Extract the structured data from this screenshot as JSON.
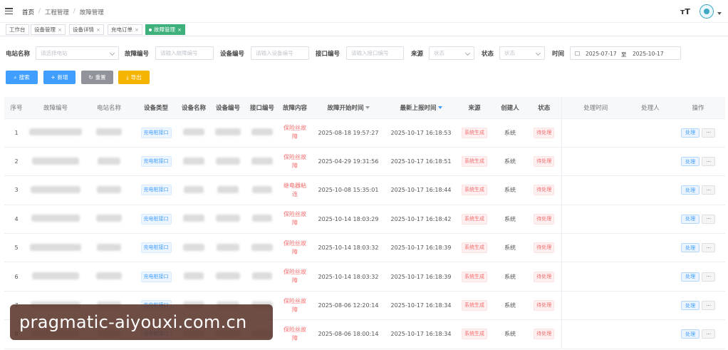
{
  "breadcrumb": [
    "首页",
    "工程管理",
    "故障管理"
  ],
  "header": {
    "font_size_label": "тT"
  },
  "tabs": [
    {
      "label": "工作台",
      "closable": false,
      "active": false
    },
    {
      "label": "设备管理",
      "closable": true,
      "active": false
    },
    {
      "label": "设备详情",
      "closable": true,
      "active": false
    },
    {
      "label": "充电订单",
      "closable": true,
      "active": false
    },
    {
      "label": "故障管理",
      "closable": true,
      "active": true
    }
  ],
  "filters": {
    "station_label": "电站名称",
    "station_placeholder": "请选择电站",
    "fault_no_label": "故障编号",
    "fault_no_placeholder": "请输入故障编号",
    "device_no_label": "设备编号",
    "device_no_placeholder": "请输入设备编号",
    "port_no_label": "接口编号",
    "port_no_placeholder": "请输入接口编号",
    "source_label": "来源",
    "source_placeholder": "状态",
    "status_label": "状态",
    "status_placeholder": "状态",
    "time_label": "时间",
    "date_from": "2025-07-17",
    "date_sep": "至",
    "date_to": "2025-10-17"
  },
  "actions": {
    "search": "搜索",
    "add": "新增",
    "reset": "重置",
    "export": "导出"
  },
  "table": {
    "columns": [
      "序号",
      "故障编号",
      "电站名称",
      "设备类型",
      "设备名称",
      "设备编号",
      "接口编号",
      "故障内容",
      "故障开始时间",
      "最新上报时间",
      "来源",
      "创建人",
      "状态",
      "处理时间",
      "处理人",
      "操作"
    ],
    "rows": [
      {
        "idx": "1",
        "type": "充电桩接口",
        "content": "保险丝故障",
        "start": "2025-08-18 19:57:27",
        "latest": "2025-10-17 16:18:53",
        "source": "系统生成",
        "creator": "系统",
        "status": "待处理"
      },
      {
        "idx": "2",
        "type": "充电桩接口",
        "content": "保险丝故障",
        "start": "2025-04-29 19:31:56",
        "latest": "2025-10-17 16:18:51",
        "source": "系统生成",
        "creator": "系统",
        "status": "待处理"
      },
      {
        "idx": "3",
        "type": "充电桩接口",
        "content": "继电器粘连",
        "start": "2025-10-08 15:35:01",
        "latest": "2025-10-17 16:18:44",
        "source": "系统生成",
        "creator": "系统",
        "status": "待处理"
      },
      {
        "idx": "4",
        "type": "充电桩接口",
        "content": "保险丝故障",
        "start": "2025-10-14 18:03:29",
        "latest": "2025-10-17 16:18:42",
        "source": "系统生成",
        "creator": "系统",
        "status": "待处理"
      },
      {
        "idx": "5",
        "type": "充电桩接口",
        "content": "保险丝故障",
        "start": "2025-10-14 18:03:32",
        "latest": "2025-10-17 16:18:39",
        "source": "系统生成",
        "creator": "系统",
        "status": "待处理"
      },
      {
        "idx": "6",
        "type": "充电桩接口",
        "content": "保险丝故障",
        "start": "2025-10-14 18:03:32",
        "latest": "2025-10-17 16:18:39",
        "source": "系统生成",
        "creator": "系统",
        "status": "待处理"
      },
      {
        "idx": "7",
        "type": "充电桩接口",
        "content": "保险丝故障",
        "start": "2025-08-06 12:20:14",
        "latest": "2025-10-17 16:18:34",
        "source": "系统生成",
        "creator": "系统",
        "status": "待处理"
      },
      {
        "idx": "8",
        "type": "充电桩接口",
        "content": "保险丝故障",
        "start": "2025-08-06 18:00:14",
        "latest": "2025-10-17 16:18:34",
        "source": "系统生成",
        "creator": "系统",
        "status": "待处理"
      }
    ],
    "row_actions": {
      "handle": "处理",
      "more": "···"
    }
  },
  "watermark": "pragmatic-aiyouxi.com.cn",
  "colors": {
    "primary": "#409eff",
    "active_tab": "#3db07c",
    "danger": "#f56c6c",
    "warning": "#f5b400",
    "watermark_bg": "#5a342a"
  }
}
